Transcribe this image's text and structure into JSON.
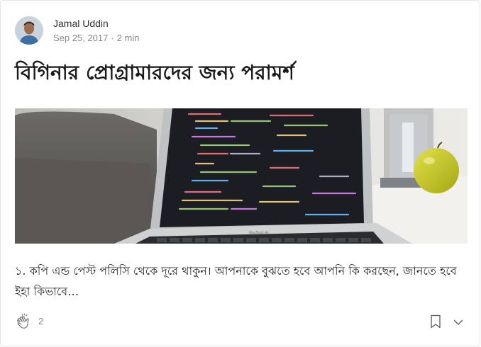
{
  "author": {
    "name": "Jamal Uddin",
    "date": "Sep 25, 2017",
    "separator": "·",
    "read_time": "2 min"
  },
  "post": {
    "title": "বিগিনার প্রোগ্রামারদের জন্য পরামর্শ",
    "excerpt": "১. কপি এন্ড পেস্ট পলিসি থেকে দূরে থাকুন। আপনাকে বুঝতে হবে আপনি কি করছেন, জানতে হবে ইহা কিভাবে…",
    "image_label": "MacBook Air"
  },
  "actions": {
    "clap_count": "2",
    "clap_icon": "clap-icon",
    "bookmark_icon": "bookmark-icon",
    "more_icon": "chevron-down-icon"
  }
}
